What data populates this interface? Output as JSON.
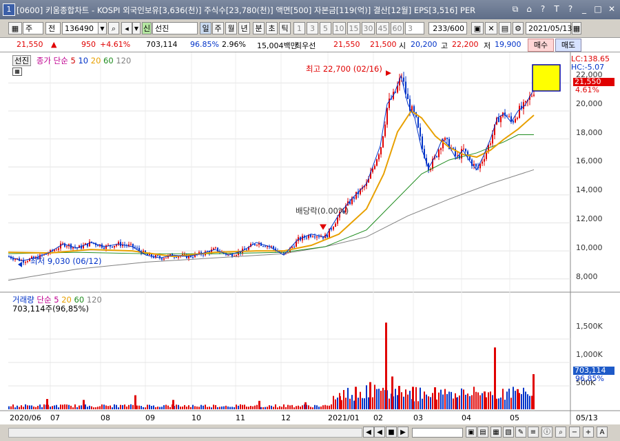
{
  "window": {
    "badge": "1",
    "title": "[0600] 키움종합차트 - KOSPI 외국인보유[3,636(천)] 주식수[23,780(천)] 액면[500] 자본금[119(억)] 결산[12월] EPS[3,516] PER",
    "buttons": [
      "⧉",
      "⌂",
      "?",
      "T",
      "?",
      "_",
      "□",
      "✕"
    ]
  },
  "toolbar": {
    "market": "주",
    "mode": "전",
    "code": "136490",
    "name": "선진",
    "tag": "신",
    "periods": [
      "일",
      "주",
      "월",
      "년",
      "분",
      "초",
      "틱"
    ],
    "minutes": [
      "1",
      "3",
      "5",
      "10",
      "15",
      "30",
      "45",
      "60"
    ],
    "count_select": "3",
    "range": "233/600",
    "date": "2021/05/13"
  },
  "info": {
    "price": "21,550",
    "arrow": "▲",
    "change": "950",
    "change_pct": "+4.61%",
    "volume": "703,114",
    "vol_ratio": "96.85%",
    "turnover": "2.96%",
    "amount": "15,004백만",
    "best_label": "최우선",
    "ask": "21,550",
    "bid": "21,500",
    "open_label": "시",
    "open": "20,200",
    "high_label": "고",
    "high": "22,200",
    "low_label": "저",
    "low": "19,900",
    "buy": "매수",
    "sell": "매도"
  },
  "price_pane": {
    "stock_tag": "선진",
    "legend_label": "종가 단순",
    "ma_periods": [
      "5",
      "10",
      "20",
      "60",
      "120"
    ],
    "ma_colors": [
      "#d20000",
      "#0032c8",
      "#e8a000",
      "#1e8c1e",
      "#808080"
    ],
    "lc": "LC:138.65",
    "hc": "HC:-5.07",
    "cur_price": "21,550",
    "cur_pct": "4.61%",
    "high_note": "최고 22,700 (02/16)",
    "low_note": "최저 9,030 (06/12)",
    "dividend_note": "배당락(0.00%)",
    "yticks": [
      "22,000",
      "20,000",
      "18,000",
      "16,000",
      "14,000",
      "12,000",
      "10,000",
      "8,000"
    ]
  },
  "volume_pane": {
    "legend_label": "거래량",
    "legend_ma": "단순",
    "ma_periods": [
      "5",
      "20",
      "60",
      "120"
    ],
    "sub": "703,114주(96,85%)",
    "yticks": [
      "1,500K",
      "1,000K",
      "500K"
    ],
    "cur_vol": "703,114",
    "cur_pct": "96,85%"
  },
  "xaxis": [
    "2020/06",
    "07",
    "08",
    "09",
    "10",
    "11",
    "12",
    "2021/01",
    "02",
    "03",
    "04",
    "05",
    "05/13"
  ],
  "chart_data": {
    "type": "candlestick",
    "ylim": [
      7200,
      23200
    ],
    "x_period": [
      "2020/06",
      "2021/05/13"
    ],
    "close_path": [
      [
        0,
        9600
      ],
      [
        20,
        9300
      ],
      [
        40,
        9500
      ],
      [
        60,
        9900
      ],
      [
        80,
        10500
      ],
      [
        100,
        10200
      ],
      [
        120,
        10600
      ],
      [
        140,
        10300
      ],
      [
        160,
        10500
      ],
      [
        180,
        10300
      ],
      [
        200,
        9700
      ],
      [
        220,
        9500
      ],
      [
        240,
        9700
      ],
      [
        260,
        9600
      ],
      [
        280,
        9800
      ],
      [
        300,
        10100
      ],
      [
        320,
        9700
      ],
      [
        340,
        10000
      ],
      [
        360,
        10600
      ],
      [
        380,
        10300
      ],
      [
        400,
        9700
      ],
      [
        420,
        10800
      ],
      [
        440,
        11200
      ],
      [
        460,
        11000
      ],
      [
        480,
        12600
      ],
      [
        500,
        13800
      ],
      [
        520,
        14800
      ],
      [
        540,
        17500
      ],
      [
        550,
        20500
      ],
      [
        560,
        21200
      ],
      [
        570,
        22500
      ],
      [
        580,
        20500
      ],
      [
        590,
        19500
      ],
      [
        600,
        17300
      ],
      [
        610,
        15900
      ],
      [
        620,
        16800
      ],
      [
        630,
        18000
      ],
      [
        640,
        17500
      ],
      [
        650,
        16600
      ],
      [
        660,
        17200
      ],
      [
        670,
        16400
      ],
      [
        680,
        15800
      ],
      [
        690,
        16800
      ],
      [
        700,
        18000
      ],
      [
        710,
        19500
      ],
      [
        720,
        19800
      ],
      [
        730,
        19200
      ],
      [
        740,
        20000
      ],
      [
        750,
        20400
      ],
      [
        763,
        21550
      ]
    ],
    "ma20": [
      [
        0,
        9900
      ],
      [
        60,
        9850
      ],
      [
        120,
        10100
      ],
      [
        180,
        10000
      ],
      [
        240,
        9600
      ],
      [
        300,
        9900
      ],
      [
        360,
        10000
      ],
      [
        400,
        10000
      ],
      [
        440,
        10400
      ],
      [
        480,
        11200
      ],
      [
        520,
        13000
      ],
      [
        545,
        15500
      ],
      [
        565,
        18500
      ],
      [
        585,
        20000
      ],
      [
        600,
        19500
      ],
      [
        620,
        18200
      ],
      [
        640,
        17400
      ],
      [
        660,
        16900
      ],
      [
        680,
        16700
      ],
      [
        700,
        17200
      ],
      [
        720,
        18000
      ],
      [
        740,
        18700
      ],
      [
        763,
        19700
      ]
    ],
    "ma60": [
      [
        0,
        9800
      ],
      [
        100,
        9900
      ],
      [
        200,
        9800
      ],
      [
        300,
        9800
      ],
      [
        400,
        9900
      ],
      [
        460,
        10300
      ],
      [
        520,
        11500
      ],
      [
        560,
        13500
      ],
      [
        600,
        15500
      ],
      [
        640,
        16500
      ],
      [
        680,
        17000
      ],
      [
        720,
        17800
      ],
      [
        740,
        18300
      ],
      [
        763,
        18300
      ]
    ],
    "ma120": [
      [
        0,
        7900
      ],
      [
        100,
        8700
      ],
      [
        200,
        9200
      ],
      [
        300,
        9500
      ],
      [
        400,
        9800
      ],
      [
        460,
        10300
      ],
      [
        520,
        11000
      ],
      [
        580,
        12500
      ],
      [
        640,
        13700
      ],
      [
        700,
        14800
      ],
      [
        763,
        15800
      ]
    ],
    "volume_spikes_k": [
      [
        55,
        220
      ],
      [
        108,
        200
      ],
      [
        183,
        300
      ],
      [
        238,
        200
      ],
      [
        363,
        180
      ],
      [
        430,
        150
      ],
      [
        480,
        280
      ],
      [
        503,
        480
      ],
      [
        524,
        580
      ],
      [
        547,
        1850
      ],
      [
        556,
        700
      ],
      [
        566,
        500
      ],
      [
        586,
        480
      ],
      [
        618,
        470
      ],
      [
        648,
        250
      ],
      [
        690,
        380
      ],
      [
        705,
        1320
      ],
      [
        738,
        430
      ],
      [
        761,
        750
      ]
    ],
    "volume_ylim": [
      0,
      2000
    ]
  }
}
